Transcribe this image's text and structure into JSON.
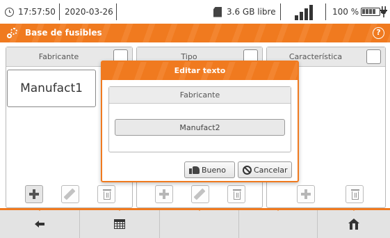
{
  "status_bar": {
    "time": "17:57:50",
    "date": "2020-03-26",
    "storage": "3.6 GB libre",
    "battery_percent": "100 %",
    "signal_level": 1.0,
    "icons": [
      "clock-icon",
      "sd-card-icon",
      "signal-icon",
      "battery-icon",
      "plug-icon"
    ]
  },
  "title_bar": {
    "title": "Base de fusibles",
    "icons": [
      "gears-icon",
      "help-icon"
    ],
    "help_symbol": "?",
    "accent_color": "#f07a1f"
  },
  "columns": [
    {
      "header": "Fabricante",
      "items": [
        "Manufact1"
      ]
    },
    {
      "header": "Tipo",
      "items": []
    },
    {
      "header": "Característica",
      "items": []
    }
  ],
  "toolbar_icons": [
    "plus-icon",
    "pencil-icon",
    "trash-icon"
  ],
  "dialog": {
    "title": "Editar texto",
    "field_label": "Fabricante",
    "field_value": "Manufact2",
    "ok_label": "Bueno",
    "cancel_label": "Cancelar",
    "icons": [
      "thumbs-up-icon",
      "cancel-icon"
    ]
  },
  "bottom_nav": {
    "icons": [
      "back-arrow-icon",
      "table-icon",
      "home-icon"
    ]
  }
}
